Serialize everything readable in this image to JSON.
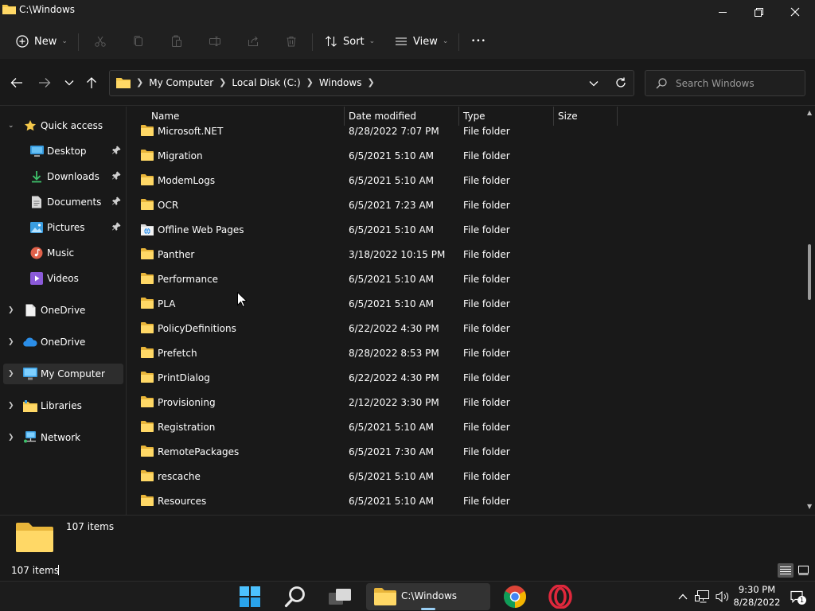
{
  "window": {
    "title": "C:\\Windows"
  },
  "commandbar": {
    "new_label": "New",
    "sort_label": "Sort",
    "view_label": "View",
    "more_label": "•••"
  },
  "address": {
    "crumbs": [
      "My Computer",
      "Local Disk (C:)",
      "Windows"
    ]
  },
  "search": {
    "placeholder": "Search Windows"
  },
  "nav": {
    "items": [
      {
        "label": "Quick access",
        "icon": "star-icon"
      },
      {
        "label": "Desktop",
        "icon": "desktop-icon"
      },
      {
        "label": "Downloads",
        "icon": "downloads-icon"
      },
      {
        "label": "Documents",
        "icon": "documents-icon"
      },
      {
        "label": "Pictures",
        "icon": "pictures-icon"
      },
      {
        "label": "Music",
        "icon": "music-icon"
      },
      {
        "label": "Videos",
        "icon": "videos-icon"
      },
      {
        "label": "OneDrive",
        "icon": "onedrive-file-icon"
      },
      {
        "label": "OneDrive",
        "icon": "onedrive-cloud-icon"
      },
      {
        "label": "My Computer",
        "icon": "computer-icon"
      },
      {
        "label": "Libraries",
        "icon": "libraries-icon"
      },
      {
        "label": "Network",
        "icon": "network-icon"
      }
    ]
  },
  "columns": {
    "name": "Name",
    "date": "Date modified",
    "type": "Type",
    "size": "Size"
  },
  "files": [
    {
      "name": "Microsoft.NET",
      "date": "8/28/2022 7:07 PM",
      "type": "File folder"
    },
    {
      "name": "Migration",
      "date": "6/5/2021 5:10 AM",
      "type": "File folder"
    },
    {
      "name": "ModemLogs",
      "date": "6/5/2021 5:10 AM",
      "type": "File folder"
    },
    {
      "name": "OCR",
      "date": "6/5/2021 7:23 AM",
      "type": "File folder"
    },
    {
      "name": "Offline Web Pages",
      "date": "6/5/2021 5:10 AM",
      "type": "File folder"
    },
    {
      "name": "Panther",
      "date": "3/18/2022 10:15 PM",
      "type": "File folder"
    },
    {
      "name": "Performance",
      "date": "6/5/2021 5:10 AM",
      "type": "File folder"
    },
    {
      "name": "PLA",
      "date": "6/5/2021 5:10 AM",
      "type": "File folder"
    },
    {
      "name": "PolicyDefinitions",
      "date": "6/22/2022 4:30 PM",
      "type": "File folder"
    },
    {
      "name": "Prefetch",
      "date": "8/28/2022 8:53 PM",
      "type": "File folder"
    },
    {
      "name": "PrintDialog",
      "date": "6/22/2022 4:30 PM",
      "type": "File folder"
    },
    {
      "name": "Provisioning",
      "date": "2/12/2022 3:30 PM",
      "type": "File folder"
    },
    {
      "name": "Registration",
      "date": "6/5/2021 5:10 AM",
      "type": "File folder"
    },
    {
      "name": "RemotePackages",
      "date": "6/5/2021 7:30 AM",
      "type": "File folder"
    },
    {
      "name": "rescache",
      "date": "6/5/2021 5:10 AM",
      "type": "File folder"
    },
    {
      "name": "Resources",
      "date": "6/5/2021 5:10 AM",
      "type": "File folder"
    }
  ],
  "details": {
    "count": "107 items"
  },
  "status": {
    "count": "107 items"
  },
  "taskbar": {
    "explorer_label": "C:\\Windows"
  },
  "clock": {
    "time": "9:30 PM",
    "date": "8/28/2022"
  },
  "notifications": {
    "count": "1"
  },
  "colors": {
    "folder": "#f4c84a",
    "accent": "#60cdff"
  }
}
